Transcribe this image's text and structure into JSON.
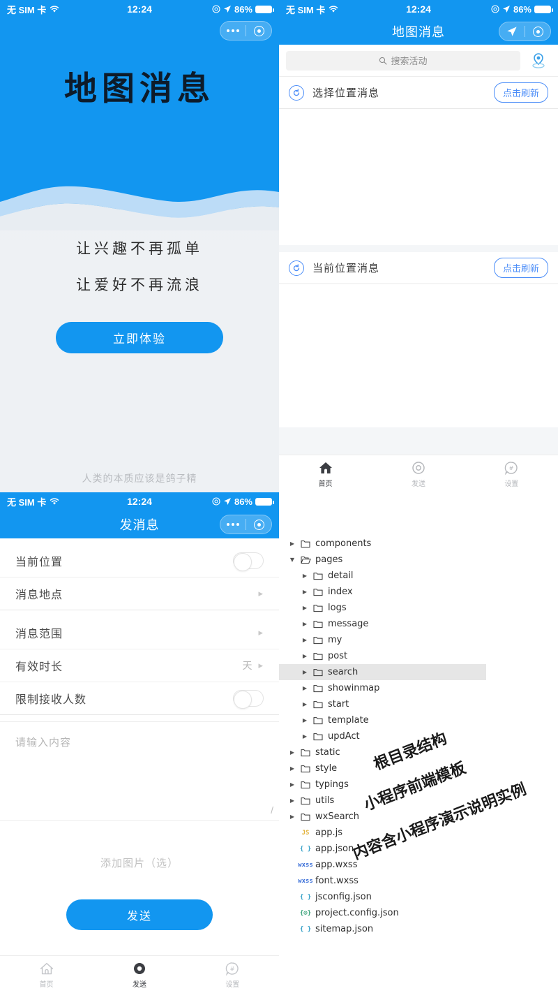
{
  "status_bar": {
    "carrier": "无 SIM 卡",
    "time": "12:24",
    "battery": "86%"
  },
  "splash": {
    "logo": "地图消息",
    "slogan_1": "让兴趣不再孤单",
    "slogan_2": "让爱好不再流浪",
    "cta_label": "立即体验",
    "footer": "人类的本质应该是鸽子精",
    "accent": "#1296f0"
  },
  "map_page": {
    "nav_title": "地图消息",
    "search_placeholder": "搜索活动",
    "sections": [
      {
        "title": "选择位置消息",
        "refresh_label": "点击刷新"
      },
      {
        "title": "当前位置消息",
        "refresh_label": "点击刷新"
      }
    ],
    "tabbar": [
      {
        "label": "首页",
        "icon": "home-icon",
        "active": true
      },
      {
        "label": "发送",
        "icon": "target-icon",
        "active": false
      },
      {
        "label": "设置",
        "icon": "settings-icon",
        "active": false
      }
    ]
  },
  "send_page": {
    "nav_title": "发消息",
    "rows_group_1": [
      {
        "label": "当前位置",
        "control": "switch",
        "value": ""
      },
      {
        "label": "消息地点",
        "control": "chevron",
        "value": ""
      }
    ],
    "rows_group_2": [
      {
        "label": "消息范围",
        "control": "chevron",
        "value": ""
      },
      {
        "label": "有效时长",
        "control": "chevron",
        "value": "天"
      },
      {
        "label": "限制接收人数",
        "control": "switch",
        "value": ""
      }
    ],
    "content_placeholder": "请输入内容",
    "add_image_label": "添加图片（选）",
    "send_label": "发送",
    "tabbar": [
      {
        "label": "首页",
        "icon": "home-icon",
        "active": false
      },
      {
        "label": "发送",
        "icon": "target-icon",
        "active": true
      },
      {
        "label": "设置",
        "icon": "settings-icon",
        "active": false
      }
    ]
  },
  "file_tree": {
    "watermark": [
      "根目录结构",
      "小程序前端模板",
      "内容含小程序演示说明实例"
    ],
    "nodes": [
      {
        "name": "components",
        "type": "folder",
        "depth": 0,
        "open": false,
        "selected": false
      },
      {
        "name": "pages",
        "type": "folder",
        "depth": 0,
        "open": true,
        "selected": false
      },
      {
        "name": "detail",
        "type": "folder",
        "depth": 1,
        "open": false,
        "selected": false
      },
      {
        "name": "index",
        "type": "folder",
        "depth": 1,
        "open": false,
        "selected": false
      },
      {
        "name": "logs",
        "type": "folder",
        "depth": 1,
        "open": false,
        "selected": false
      },
      {
        "name": "message",
        "type": "folder",
        "depth": 1,
        "open": false,
        "selected": false
      },
      {
        "name": "my",
        "type": "folder",
        "depth": 1,
        "open": false,
        "selected": false
      },
      {
        "name": "post",
        "type": "folder",
        "depth": 1,
        "open": false,
        "selected": false
      },
      {
        "name": "search",
        "type": "folder",
        "depth": 1,
        "open": false,
        "selected": true
      },
      {
        "name": "showinmap",
        "type": "folder",
        "depth": 1,
        "open": false,
        "selected": false
      },
      {
        "name": "start",
        "type": "folder",
        "depth": 1,
        "open": false,
        "selected": false
      },
      {
        "name": "template",
        "type": "folder",
        "depth": 1,
        "open": false,
        "selected": false
      },
      {
        "name": "updAct",
        "type": "folder",
        "depth": 1,
        "open": false,
        "selected": false
      },
      {
        "name": "static",
        "type": "folder",
        "depth": 0,
        "open": false,
        "selected": false
      },
      {
        "name": "style",
        "type": "folder",
        "depth": 0,
        "open": false,
        "selected": false
      },
      {
        "name": "typings",
        "type": "folder",
        "depth": 0,
        "open": false,
        "selected": false
      },
      {
        "name": "utils",
        "type": "folder",
        "depth": 0,
        "open": false,
        "selected": false
      },
      {
        "name": "wxSearch",
        "type": "folder",
        "depth": 0,
        "open": false,
        "selected": false
      },
      {
        "name": "app.js",
        "type": "js",
        "depth": 0,
        "badge": "JS",
        "color": "#e2b33c"
      },
      {
        "name": "app.json",
        "type": "json",
        "depth": 0,
        "badge": "{ }",
        "color": "#35a0c7"
      },
      {
        "name": "app.wxss",
        "type": "wxss",
        "depth": 0,
        "badge": "wxss",
        "color": "#3a6fd8"
      },
      {
        "name": "font.wxss",
        "type": "wxss",
        "depth": 0,
        "badge": "wxss",
        "color": "#3a6fd8"
      },
      {
        "name": "jsconfig.json",
        "type": "json",
        "depth": 0,
        "badge": "{ }",
        "color": "#35a0c7"
      },
      {
        "name": "project.config.json",
        "type": "config",
        "depth": 0,
        "badge": "{⊙}",
        "color": "#3aa37a"
      },
      {
        "name": "sitemap.json",
        "type": "json",
        "depth": 0,
        "badge": "{ }",
        "color": "#35a0c7"
      }
    ]
  }
}
